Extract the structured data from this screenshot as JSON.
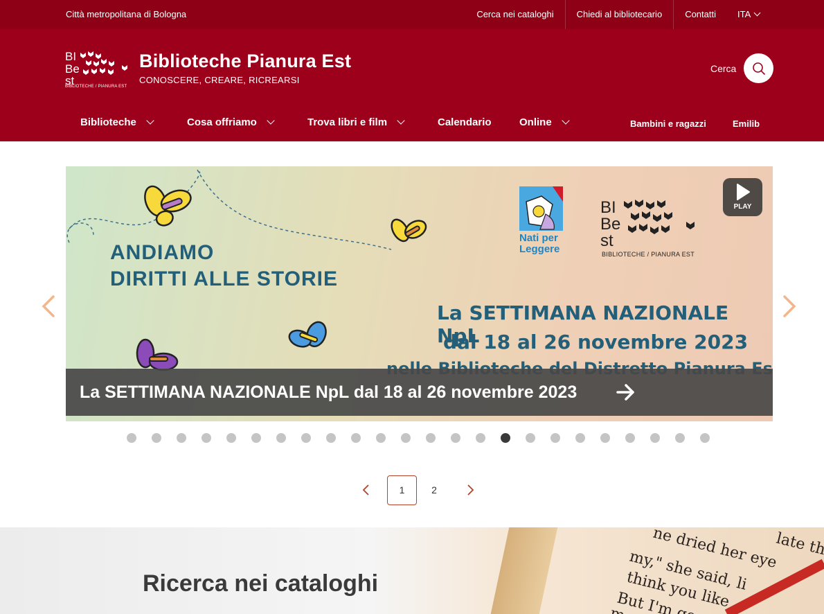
{
  "topbar": {
    "region": "Città metropolitana di Bologna",
    "links": [
      "Cerca nei cataloghi",
      "Chiedi al bibliotecario",
      "Contatti"
    ],
    "lang": "ITA"
  },
  "header": {
    "title": "Biblioteche Pianura Est",
    "tagline": "CONOSCERE, CREARE, RICREARSI",
    "logo_subtext": "BIBLIOTECHE / PIANURA EST",
    "search_label": "Cerca"
  },
  "nav": {
    "items": [
      "Biblioteche",
      "Cosa offriamo",
      "Trova libri e film",
      "Calendario",
      "Online"
    ],
    "right": [
      "Bambini e ragazzi",
      "Emilib"
    ]
  },
  "carousel": {
    "slide": {
      "heading1": "ANDIAMO",
      "heading2": "DIRITTI ALLE STORIE",
      "npl_line1": "La SETTIMANA NAZIONALE NpL",
      "npl_line2": "dal 18 al 26 novembre 2023",
      "npl_line3": "nelle Biblioteche del Distretto Pianura Est",
      "npl_logo_text": "Nati per Leggere",
      "bibest_sub": "BIBLIOTECHE / PIANURA EST"
    },
    "play_label": "PLAY",
    "caption": "La SETTIMANA NAZIONALE NpL dal 18 al 26 novembre 2023",
    "dots_total": 24,
    "dots_active": 16
  },
  "pagination": {
    "current": "1",
    "next_page": "2"
  },
  "catalog": {
    "title": "Ricerca nei cataloghi"
  },
  "colors": {
    "brand": "#9d001a",
    "topbar": "#8e0016",
    "accent": "#b3442a"
  }
}
